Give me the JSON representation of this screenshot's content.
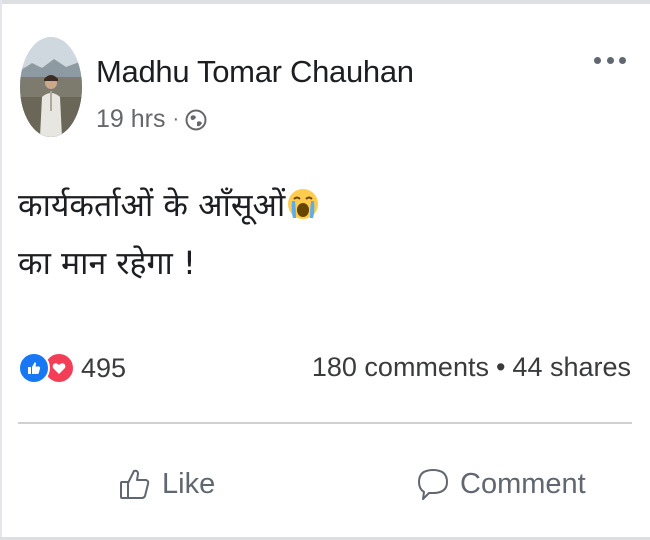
{
  "post": {
    "author": "Madhu Tomar Chauhan",
    "time": "19 hrs",
    "separator": "·",
    "audience_icon": "globe-icon",
    "text_line_1": "कार्यकर्ताओं के आँसूओं",
    "text_emoji": "loudly-crying-face",
    "text_line_2": "का मान रहेगा !"
  },
  "engagement": {
    "reaction_icons": [
      "like-reaction-icon",
      "love-reaction-icon"
    ],
    "reaction_count": "495",
    "comments": "180 comments",
    "separator": "•",
    "shares": "44 shares"
  },
  "actions": {
    "like_label": "Like",
    "comment_label": "Comment"
  },
  "colors": {
    "like_blue": "#1877f2",
    "love_red": "#f33e58",
    "secondary_text": "#65676b"
  }
}
